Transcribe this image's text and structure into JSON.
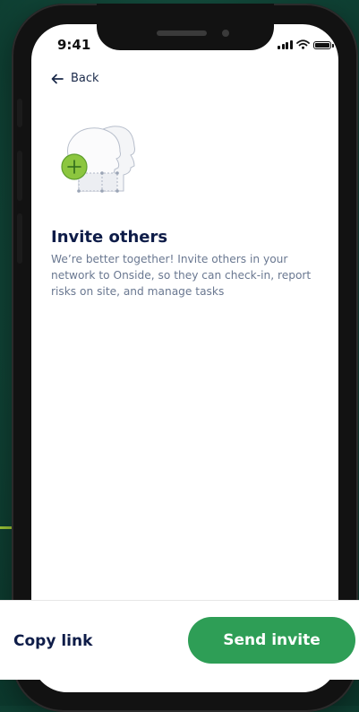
{
  "status_bar": {
    "time": "9:41"
  },
  "nav": {
    "back_label": "Back"
  },
  "invite": {
    "title": "Invite others",
    "description": "We’re better together! Invite others in your network to Onside, so they can check-in, report risks on site, and manage tasks"
  },
  "actions": {
    "copy_link_label": "Copy link",
    "send_invite_label": "Send invite"
  },
  "colors": {
    "accent": "#2e9e56",
    "lime": "#a6d13a",
    "background": "#134c3d",
    "title": "#0e1c48"
  }
}
